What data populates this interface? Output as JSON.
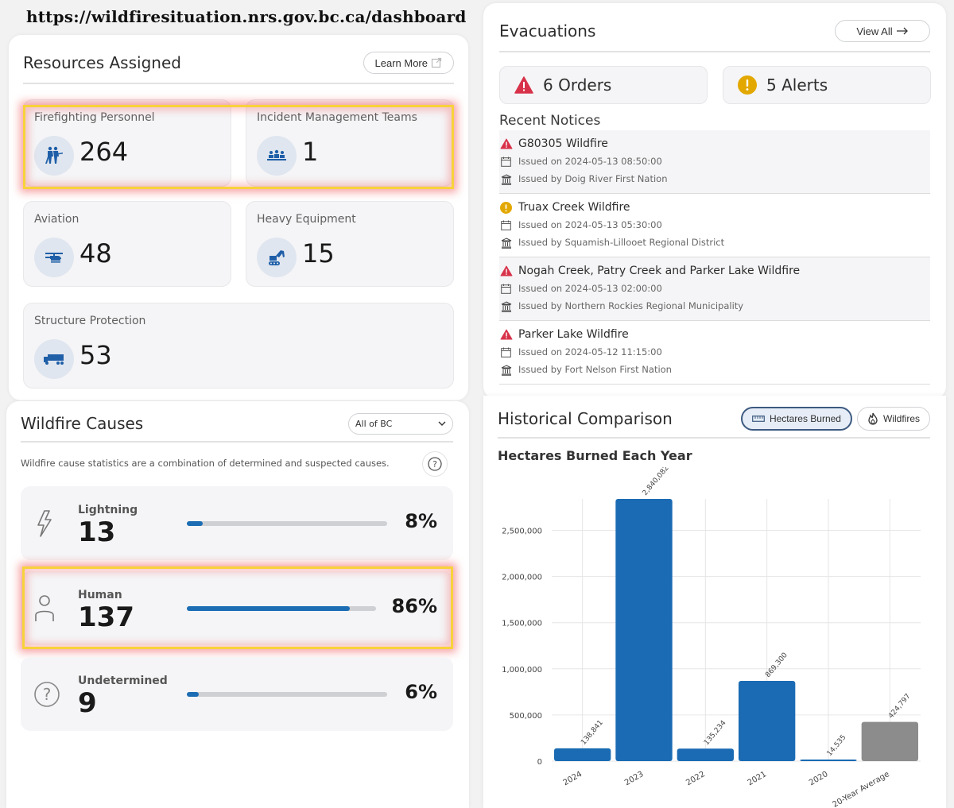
{
  "url_caption": "https://wildfiresituation.nrs.gov.bc.ca/dashboard",
  "resources": {
    "title": "Resources Assigned",
    "learn_more_label": "Learn More",
    "cards": [
      {
        "label": "Firefighting Personnel",
        "value": "264",
        "icon": "firefighters-icon"
      },
      {
        "label": "Incident Management Teams",
        "value": "1",
        "icon": "teams-icon"
      },
      {
        "label": "Aviation",
        "value": "48",
        "icon": "helicopter-icon"
      },
      {
        "label": "Heavy Equipment",
        "value": "15",
        "icon": "excavator-icon"
      },
      {
        "label": "Structure Protection",
        "value": "53",
        "icon": "truck-icon"
      }
    ]
  },
  "causes": {
    "title": "Wildfire Causes",
    "region_select": "All of BC",
    "note": "Wildfire cause statistics are a combination of determined and suspected causes.",
    "items": [
      {
        "label": "Lightning",
        "count": "13",
        "percent": 8,
        "percent_label": "8%",
        "icon": "lightning-icon"
      },
      {
        "label": "Human",
        "count": "137",
        "percent": 86,
        "percent_label": "86%",
        "icon": "person-icon"
      },
      {
        "label": "Undetermined",
        "count": "9",
        "percent": 6,
        "percent_label": "6%",
        "icon": "question-icon"
      }
    ]
  },
  "evacuations": {
    "title": "Evacuations",
    "view_all_label": "View All",
    "orders_label": "6 Orders",
    "alerts_label": "5 Alerts",
    "recent_title": "Recent Notices",
    "notices": [
      {
        "type": "order",
        "title": "G80305 Wildfire",
        "issued_on": "Issued on 2024-05-13 08:50:00",
        "issued_by": "Issued by Doig River First Nation"
      },
      {
        "type": "alert",
        "title": "Truax Creek Wildfire",
        "issued_on": "Issued on 2024-05-13 05:30:00",
        "issued_by": "Issued by Squamish-Lillooet Regional District"
      },
      {
        "type": "order",
        "title": "Nogah Creek, Patry Creek and Parker Lake Wildfire",
        "issued_on": "Issued on 2024-05-13 02:00:00",
        "issued_by": "Issued by Northern Rockies Regional Municipality"
      },
      {
        "type": "order",
        "title": "Parker Lake Wildfire",
        "issued_on": "Issued on 2024-05-12 11:15:00",
        "issued_by": "Issued by Fort Nelson First Nation"
      }
    ]
  },
  "historical": {
    "title": "Historical Comparison",
    "toggle_hectares": "Hectares Burned",
    "toggle_wildfires": "Wildfires",
    "active_toggle": "Hectares Burned"
  },
  "colors": {
    "primary_bar": "#1a6bb3",
    "average_bar": "#8c8c8c",
    "order_red": "#d8324a",
    "alert_yellow": "#e3a800"
  },
  "chart_data": {
    "type": "bar",
    "title": "Hectares Burned Each Year",
    "xlabel": "",
    "ylabel": "",
    "categories": [
      "2024",
      "2023",
      "2022",
      "2021",
      "2020",
      "20-Year Average"
    ],
    "values": [
      138841,
      2840082,
      135234,
      869300,
      14535,
      424797
    ],
    "value_labels": [
      "138,841",
      "2,840,082",
      "135,234",
      "869,300",
      "14,535",
      "424,797"
    ],
    "ylim": [
      0,
      2840082
    ],
    "yticks": [
      0,
      500000,
      1000000,
      1500000,
      2000000,
      2500000
    ],
    "ytick_labels": [
      "0",
      "500,000",
      "1,000,000",
      "1,500,000",
      "2,000,000",
      "2,500,000"
    ],
    "grid": true,
    "legend": "none"
  }
}
